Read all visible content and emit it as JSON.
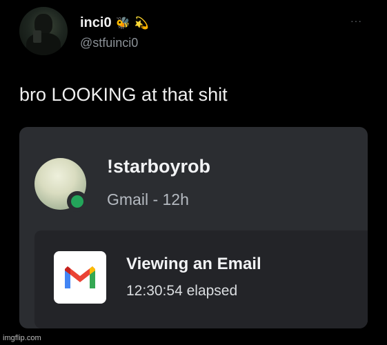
{
  "tweet": {
    "display_name": "inci0",
    "name_emojis": [
      "🐝",
      "💫"
    ],
    "handle": "@stfuinci0",
    "more_icon": "···",
    "text": "bro LOOKING at that shit"
  },
  "discord_card": {
    "username": "!starboyrob",
    "activity_sub": "Gmail - 12h",
    "status": "online",
    "status_color": "#23a55a",
    "activity": {
      "app_icon": "gmail-icon",
      "title": "Viewing an Email",
      "elapsed": "12:30:54 elapsed"
    }
  },
  "watermark": "imgflip.com",
  "colors": {
    "background": "#000000",
    "card_bg": "#2b2d31",
    "activity_bg": "#232428",
    "handle_gray": "#8b9197"
  }
}
